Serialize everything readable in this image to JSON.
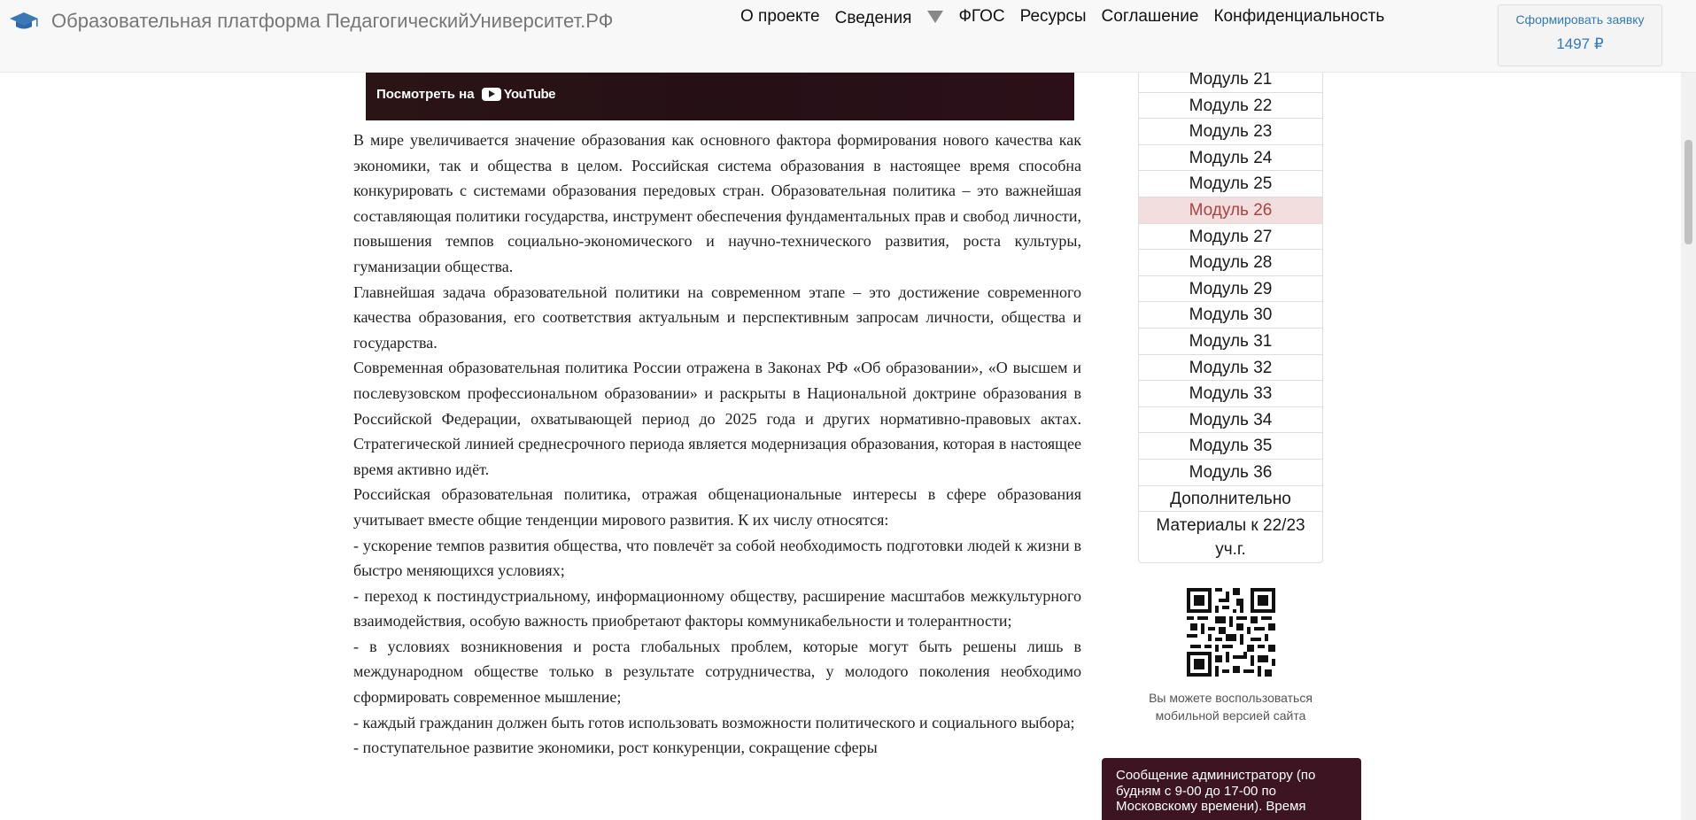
{
  "header": {
    "brand_title": "Образовательная платформа ПедагогическийУниверситет.РФ",
    "brand_icon": "graduation-cap-icon",
    "nav": [
      {
        "label": "О проекте"
      },
      {
        "label": "Сведения"
      },
      {
        "label": "ФГОС"
      },
      {
        "label": "Ресурсы"
      },
      {
        "label": "Соглашение"
      },
      {
        "label": "Конфиденциальность"
      }
    ],
    "order": {
      "label": "Сформировать заявку",
      "price": "1497 ₽"
    }
  },
  "video": {
    "watch_on_label": "Посмотреть на",
    "youtube_label": "YouTube"
  },
  "article": {
    "paragraphs": [
      "В мире увеличивается значение образования как основного фактора формирования нового качества как экономики, так и общества в целом. Российская система образования в настоящее время способна конкурировать с системами образования передовых стран. Образовательная политика – это важнейшая составляющая политики государства, инструмент обеспечения фундаментальных прав и свобод личности, повышения темпов социально-экономического и научно-технического развития, роста культуры, гуманизации общества.",
      "Главнейшая задача образовательной политики на современном этапе – это достижение современного качества образования, его соответствия актуальным и перспективным запросам личности, общества и государства.",
      "Современная образовательная политика России отражена в Законах РФ «Об образовании», «О высшем и послевузовском профессиональном образовании» и раскрыты в Национальной доктрине образования в Российской Федерации, охватывающей период до 2025 года и других нормативно-правовых актах. Стратегической линией среднесрочного периода является модернизация образования, которая в настоящее время активно идёт.",
      "Российская образовательная политика, отражая общенациональные интересы в сфере образования учитывает вместе общие тенденции мирового развития. К их числу относятся:",
      "- ускорение темпов развития общества, что повлечёт за собой необходимость подготовки людей к жизни в быстро меняющихся условиях;",
      "- переход к постиндустриальному, информационному обществу, расширение масштабов межкультурного взаимодействия, особую важность приобретают факторы коммуникабельности и толерантности;",
      "- в условиях возникновения и роста глобальных проблем, которые могут быть решены лишь в международном обществе только в результате сотрудничества, у молодого поколения необходимо сформировать современное мышление;",
      "- каждый гражданин должен быть готов использовать возможности политического и социального выбора;",
      "- поступательное развитие экономики, рост конкуренции, сокращение сферы"
    ]
  },
  "sidebar": {
    "modules": [
      {
        "label": "Модуль 21"
      },
      {
        "label": "Модуль 22"
      },
      {
        "label": "Модуль 23"
      },
      {
        "label": "Модуль 24"
      },
      {
        "label": "Модуль 25"
      },
      {
        "label": "Модуль 26",
        "active": true
      },
      {
        "label": "Модуль 27"
      },
      {
        "label": "Модуль 28"
      },
      {
        "label": "Модуль 29"
      },
      {
        "label": "Модуль 30"
      },
      {
        "label": "Модуль 31"
      },
      {
        "label": "Модуль 32"
      },
      {
        "label": "Модуль 33"
      },
      {
        "label": "Модуль 34"
      },
      {
        "label": "Модуль 35"
      },
      {
        "label": "Модуль 36"
      },
      {
        "label": "Дополнительно"
      },
      {
        "label": "Материалы к 22/23 уч.г."
      }
    ],
    "qr_caption": "Вы можете воспользоваться мобильной версией сайта"
  },
  "admin_message": {
    "text": "Сообщение администратору (по будням с 9-00 до 17-00 по Московскому времени). Время"
  },
  "colors": {
    "active_module_bg": "#f2dede",
    "active_module_text": "#a94442",
    "link": "#337ab7",
    "admin_bg": "#3d1422"
  }
}
